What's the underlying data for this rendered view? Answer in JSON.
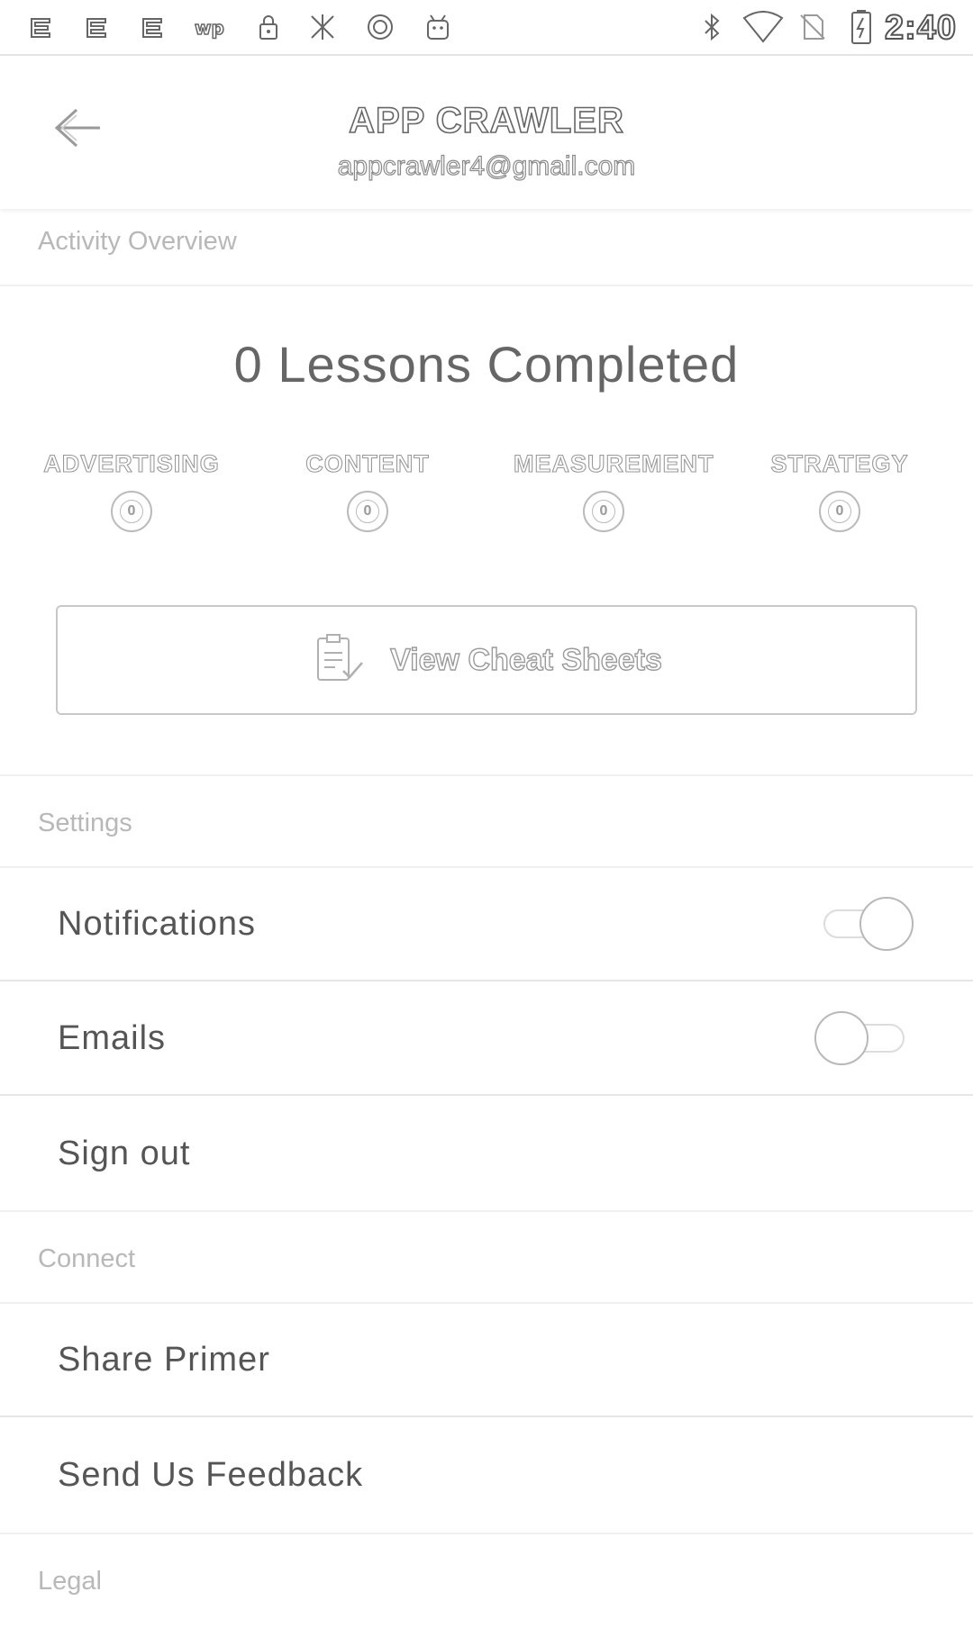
{
  "status_bar": {
    "time": "2:40",
    "icons": [
      "notification-icon",
      "notification-icon",
      "notification-icon",
      "wp-icon",
      "lock-icon",
      "notification-icon",
      "circle-icon",
      "android-icon",
      "bluetooth-icon",
      "wifi-icon",
      "no-sim-icon",
      "battery-charging-icon"
    ]
  },
  "header": {
    "title": "APP CRAWLER",
    "subtitle": "appcrawler4@gmail.com",
    "back_icon": "arrow-left-icon"
  },
  "activity": {
    "section_label": "Activity Overview",
    "lessons_completed": "0 Lessons Completed",
    "categories": [
      {
        "name": "ADVERTISING",
        "count": "0"
      },
      {
        "name": "CONTENT",
        "count": "0"
      },
      {
        "name": "MEASUREMENT",
        "count": "0"
      },
      {
        "name": "STRATEGY",
        "count": "0"
      }
    ],
    "cheat_sheets_label": "View Cheat Sheets",
    "cheat_sheets_icon": "clipboard-check-icon"
  },
  "settings": {
    "section_label": "Settings",
    "items": [
      {
        "label": "Notifications",
        "toggle": true
      },
      {
        "label": "Emails",
        "toggle": false
      },
      {
        "label": "Sign out"
      }
    ]
  },
  "connect": {
    "section_label": "Connect",
    "items": [
      {
        "label": "Share Primer"
      },
      {
        "label": "Send Us Feedback"
      }
    ]
  },
  "legal": {
    "section_label": "Legal"
  },
  "colors": {
    "background": "#ffffff",
    "text": "#555555",
    "section_text": "#b8b8b8",
    "divider": "#e6e6e6"
  }
}
